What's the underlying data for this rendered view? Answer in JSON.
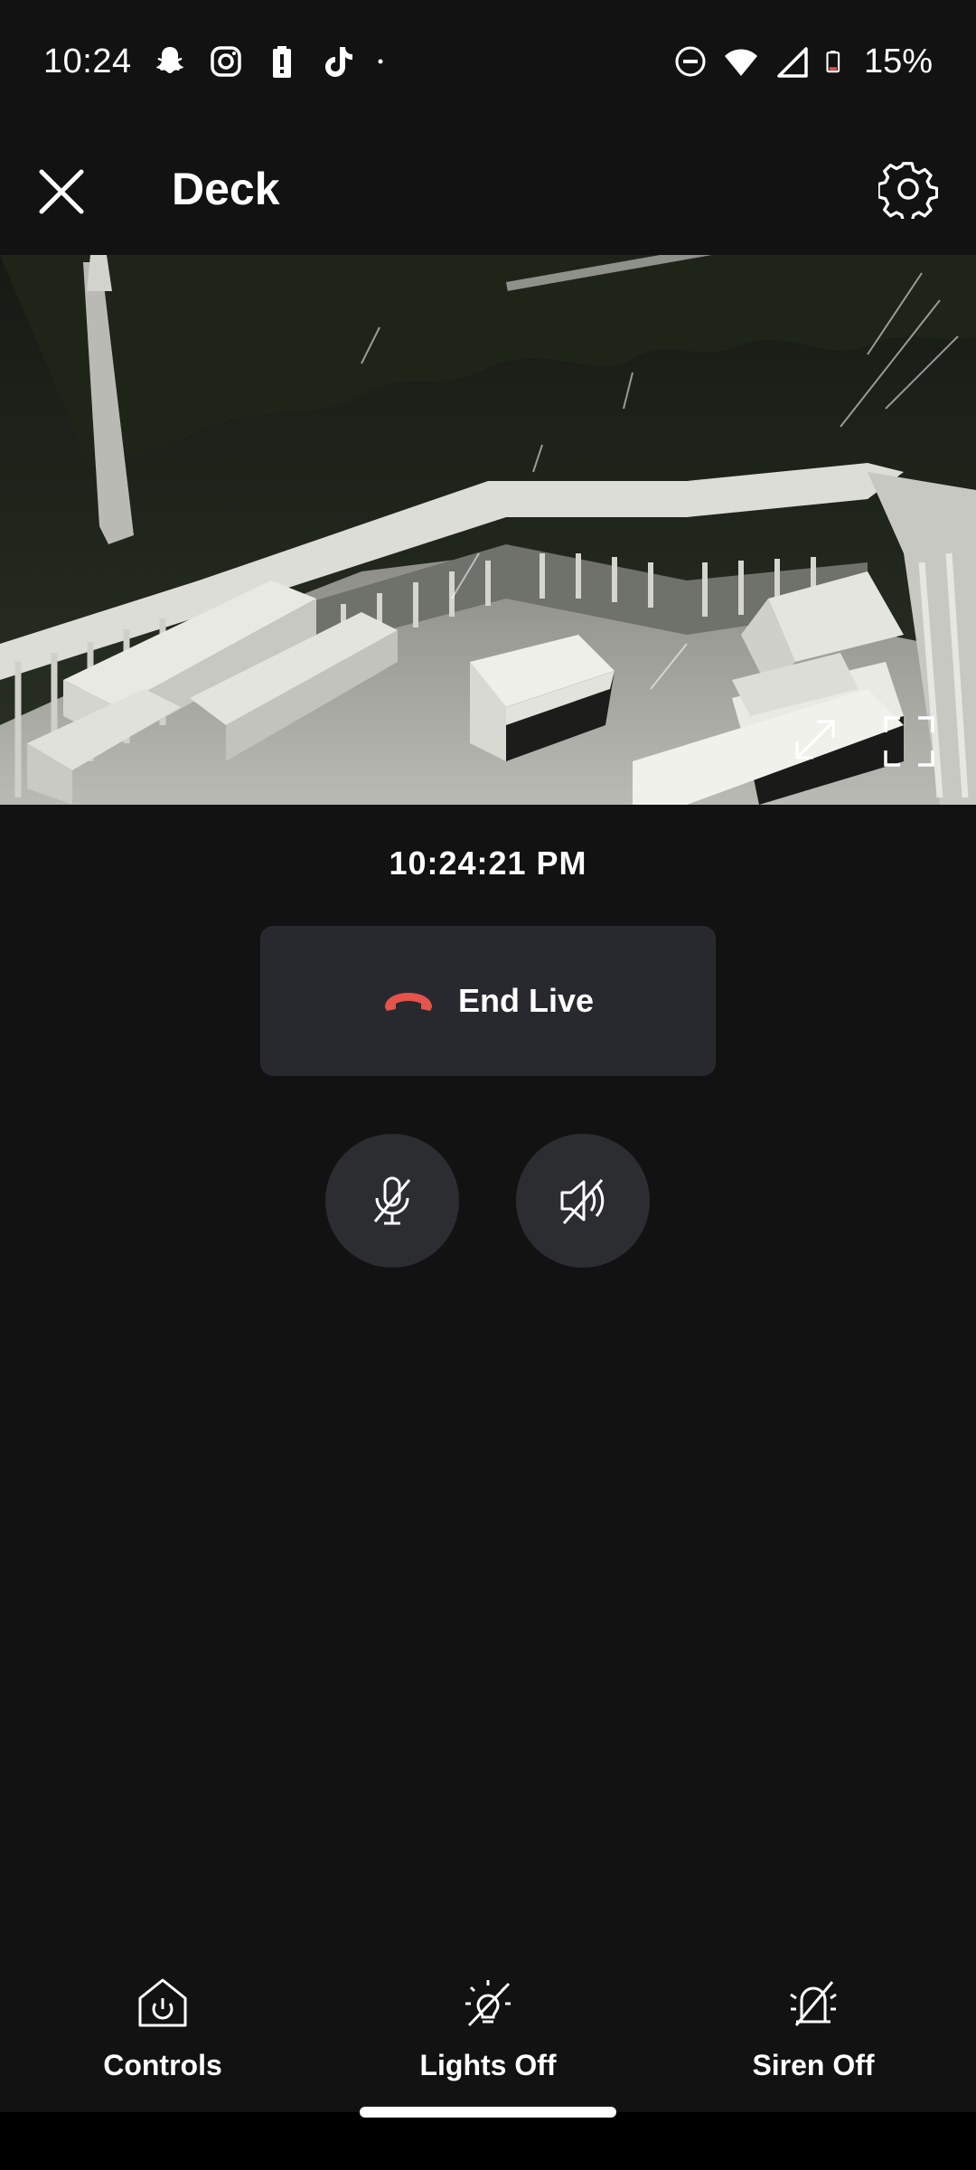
{
  "status_bar": {
    "time": "10:24",
    "battery_percent": "15%",
    "left_icons": [
      "snapchat-icon",
      "instagram-icon",
      "battery-alert-icon",
      "tiktok-icon",
      "dot-icon"
    ],
    "right_icons": [
      "do-not-disturb-icon",
      "wifi-icon",
      "signal-icon",
      "battery-icon"
    ]
  },
  "header": {
    "title": "Deck",
    "close_icon": "close-icon",
    "settings_icon": "gear-icon"
  },
  "camera": {
    "expand_icon": "expand-icon",
    "fullscreen_icon": "fullscreen-icon"
  },
  "live": {
    "timestamp": "10:24:21 PM",
    "end_label": "End Live",
    "end_icon": "hang-up-icon",
    "end_icon_color": "#e5534b"
  },
  "audio_controls": {
    "mic_icon": "microphone-muted-icon",
    "speaker_icon": "speaker-muted-icon"
  },
  "bottom_bar": {
    "items": [
      {
        "label": "Controls",
        "icon": "home-power-icon"
      },
      {
        "label": "Lights Off",
        "icon": "light-off-icon"
      },
      {
        "label": "Siren Off",
        "icon": "siren-off-icon"
      }
    ]
  },
  "colors": {
    "background": "#121212",
    "button_bg": "#28292e",
    "round_button_bg": "#2c2d31",
    "text": "#ffffff",
    "accent_red": "#e5534b"
  }
}
